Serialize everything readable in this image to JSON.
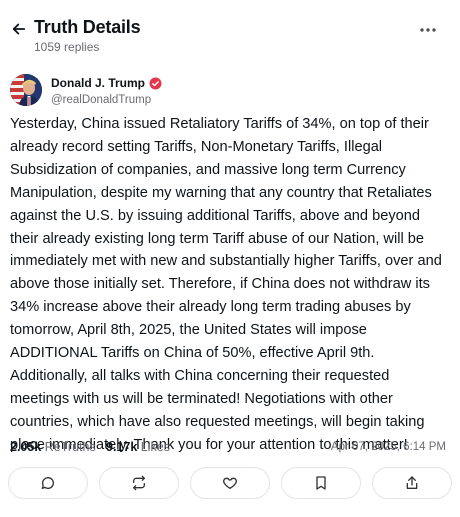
{
  "header": {
    "title": "Truth Details",
    "replies": "1059 replies",
    "back_icon": "arrow-left-icon",
    "more_icon": "more-horizontal-icon"
  },
  "author": {
    "name": "Donald J. Trump",
    "handle": "@realDonaldTrump",
    "verified_color": "#e5364b"
  },
  "post": {
    "text": "Yesterday, China issued Retaliatory Tariffs of 34%, on top of their already record setting Tariffs, Non-Monetary Tariffs, Illegal Subsidization of companies, and massive long term Currency Manipulation, despite my warning that any country that Retaliates against the U.S. by issuing additional Tariffs, above and beyond their already existing long term Tariff abuse of our Nation, will be immediately met with new and substantially higher Tariffs, over and above those initially set. Therefore, if China does not withdraw its 34% increase above their already long term trading abuses by tomorrow, April 8th, 2025, the United States will impose ADDITIONAL Tariffs on China of 50%, effective April 9th. Additionally, all talks with China concerning their requested meetings with us will be terminated! Negotiations with other countries, which have also requested meetings, will begin taking place immediately. Thank you for your attention to this matter!"
  },
  "stats": {
    "retruths_count": "2.05k",
    "retruths_label": "ReTruths",
    "likes_count": "9.17k",
    "likes_label": "Likes",
    "timestamp": "Apr 07, 2025, 6:14 PM"
  },
  "actions": [
    {
      "icon": "reply-icon"
    },
    {
      "icon": "retruth-icon"
    },
    {
      "icon": "like-icon"
    },
    {
      "icon": "bookmark-icon"
    },
    {
      "icon": "share-icon"
    }
  ]
}
